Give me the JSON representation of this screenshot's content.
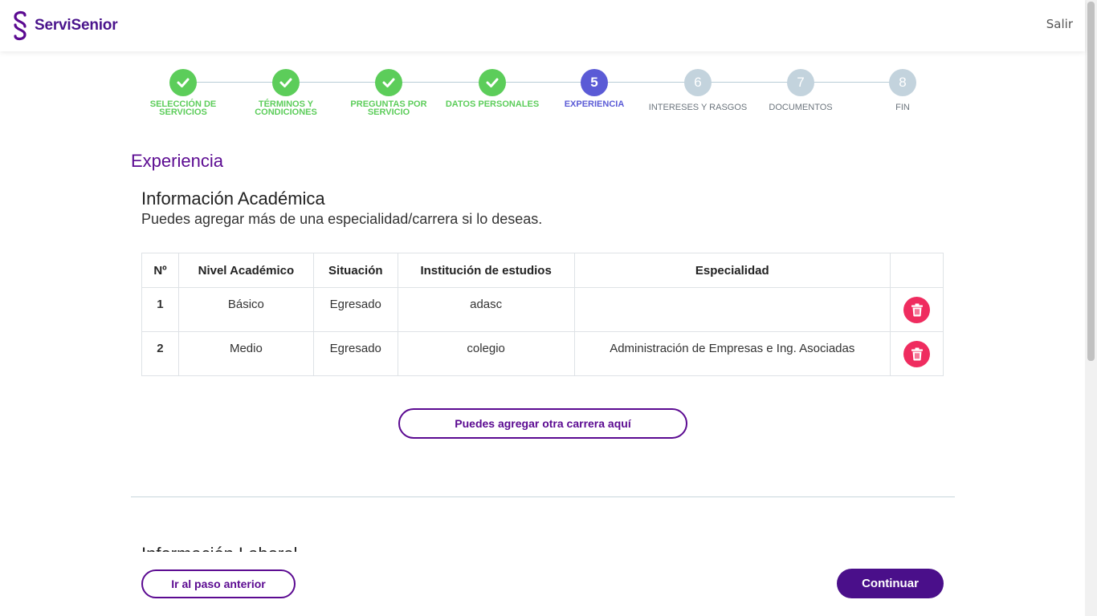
{
  "header": {
    "brand": "ServiSenior",
    "logout_label": "Salir"
  },
  "stepper": {
    "steps": [
      {
        "number": "1",
        "label": "SELECCIÓN DE SERVICIOS",
        "status": "done"
      },
      {
        "number": "2",
        "label": "TÉRMINOS Y CONDICIONES",
        "status": "done"
      },
      {
        "number": "3",
        "label": "PREGUNTAS POR SERVICIO",
        "status": "done"
      },
      {
        "number": "4",
        "label": "DATOS PERSONALES",
        "status": "done"
      },
      {
        "number": "5",
        "label": "EXPERIENCIA",
        "status": "active"
      },
      {
        "number": "6",
        "label": "INTERESES Y RASGOS",
        "status": "pending"
      },
      {
        "number": "7",
        "label": "DOCUMENTOS",
        "status": "pending"
      },
      {
        "number": "8",
        "label": "FIN",
        "status": "pending"
      }
    ]
  },
  "page": {
    "title": "Experiencia"
  },
  "academic": {
    "title": "Información Académica",
    "subtitle": "Puedes agregar más de una especialidad/carrera si lo deseas.",
    "columns": [
      "Nº",
      "Nivel Académico",
      "Situación",
      "Institución de estudios",
      "Especialidad",
      ""
    ],
    "rows": [
      {
        "n": "1",
        "nivel": "Básico",
        "situacion": "Egresado",
        "institucion": "adasc",
        "especialidad": ""
      },
      {
        "n": "2",
        "nivel": "Medio",
        "situacion": "Egresado",
        "institucion": "colegio",
        "especialidad": "Administración de Empresas e Ing. Asociadas"
      }
    ],
    "add_button": "Puedes agregar otra carrera aquí"
  },
  "next_section": {
    "title": "Información Laboral"
  },
  "footer": {
    "prev_button": "Ir al paso anterior",
    "continue_button": "Continuar"
  },
  "colors": {
    "brand": "#5b0a91",
    "done": "#5ccd5a",
    "active": "#5b5bd6",
    "pending": "#c3d3dd",
    "delete": "#ef2c5f"
  }
}
